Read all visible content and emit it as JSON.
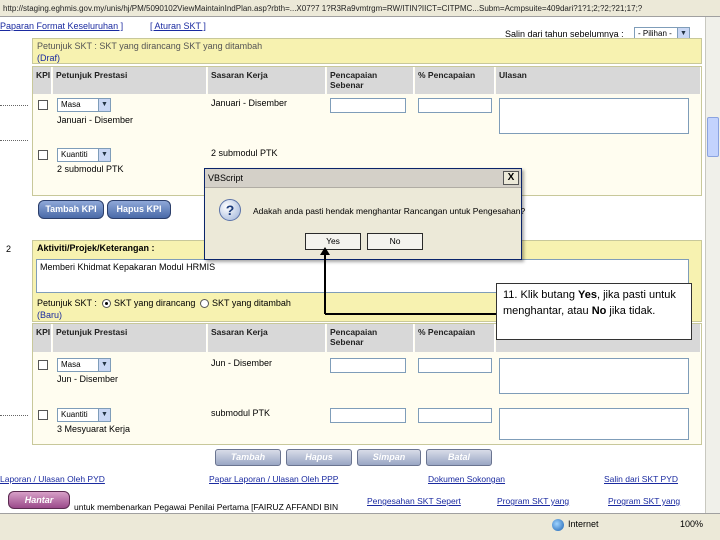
{
  "browser": {
    "address_url": "http://staging.eghmis.gov.my/unis/hj/PM/5090102ViewMaintainIndPlan.asp?rbth=...X07?7 1?R3Ra9vmtrgm=RW/ITIN?IICT=CITPMC...Subm=Acmpsuite=409dari?1?1;2;?2;?21;17;?"
  },
  "top": {
    "link_cetak": "Paparan Format Keseluruhan ]",
    "link_aturan": "[ Aturan SKT ]",
    "salin_label": "Salin dari tahun sebelumnya :",
    "pilihan_select": "- Pilihan -",
    "petunjuk_faded": "Petunjuk SKT :   SKT yang dirancang   SKT yang ditambah",
    "draf_label": "(Draf)"
  },
  "table1": {
    "headers": {
      "kpi": "KPI",
      "petunjuk": "Petunjuk Prestasi",
      "sasaran": "Sasaran Kerja",
      "pencapaian": "Pencapaian Sebenar",
      "peratus": "% Pencapaian",
      "ulasan": "Ulasan"
    },
    "rows": [
      {
        "select": "Masa",
        "petunjuk": "Januari - Disember",
        "sasaran": "Januari - Disember"
      },
      {
        "select": "Kuantiti",
        "petunjuk": "2 submodul PTK",
        "sasaran": "2 submodul PTK"
      }
    ]
  },
  "buttons1": {
    "tambah_kpi": "Tambah KPI",
    "hapus_kpi": "Hapus KPI"
  },
  "section2": {
    "row_number": "2",
    "aktiviti_label": "Aktiviti/Projek/Keterangan :",
    "aktiviti_value": "Memberi Khidmat Kepakaran Modul HRMIS",
    "petunjuk_label": "Petunjuk SKT :",
    "radio_dirancang": "SKT yang dirancang",
    "radio_ditambah": "SKT yang ditambah",
    "status": "(Baru)"
  },
  "table2": {
    "rows": [
      {
        "select": "Masa",
        "petunjuk": "Jun - Disember",
        "sasaran": "Jun - Disember"
      },
      {
        "select": "Kuantiti",
        "petunjuk": "3 Mesyuarat Kerja",
        "sasaran": "submodul PTK"
      }
    ]
  },
  "buttons2": {
    "tambah": "Tambah",
    "hapus": "Hapus",
    "simpan": "Simpan",
    "batal": "Batal"
  },
  "footer": {
    "link_laporan_ppp": "Laporan / Ulasan Oleh PYD",
    "link_laporan_ppp2": "Papar Laporan / Ulasan Oleh PPP",
    "link_dokumen": "Dokumen Sokongan",
    "link_salin": "Salin dari SKT PYD",
    "link_pengesahan": "Pengesahan SKT Sepert",
    "link_program1": "Program SKT yang",
    "link_program2": "Program SKT yang",
    "hantar": "Hantar",
    "hantar_text": "untuk membenarkan Pegawai Penilai Pertama [FAIRUZ AFFANDI BIN"
  },
  "statusbar": {
    "zone": "Internet",
    "zoom": "100%"
  },
  "dialog": {
    "title": "VBScript",
    "close_glyph": "X",
    "icon_glyph": "?",
    "message": "Adakah anda pasti hendak menghantar Rancangan untuk Pengesahan?",
    "yes": "Yes",
    "no": "No"
  },
  "callout": {
    "prefix": "11. Klik butang ",
    "yes": "Yes",
    "mid": ", jika pasti untuk menghantar, atau ",
    "no": "No",
    "suffix": " jika tidak."
  }
}
